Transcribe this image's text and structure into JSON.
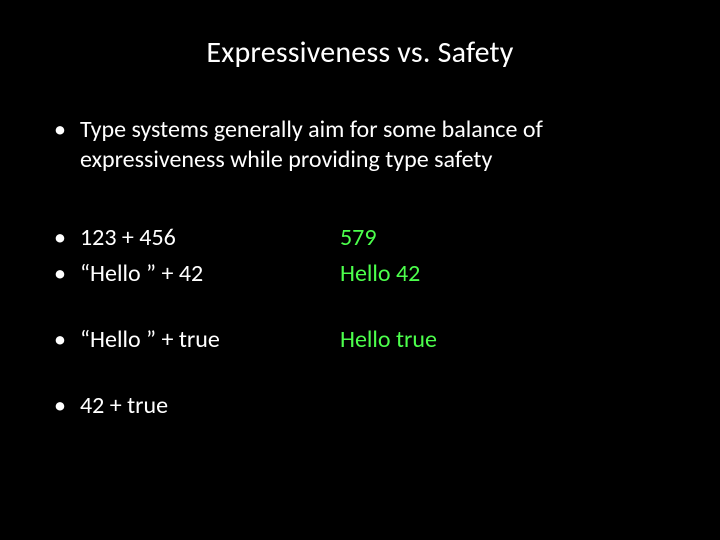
{
  "title": "Expressiveness vs. Safety",
  "intro": "Type systems generally aim for some balance of expressiveness while providing type safety",
  "rows": [
    {
      "lhs": "123 + 456",
      "rhs": "579"
    },
    {
      "lhs": "“Hello ” + 42",
      "rhs": "Hello 42"
    },
    {
      "lhs": "“Hello ” + true",
      "rhs": "Hello true"
    },
    {
      "lhs": "42 + true",
      "rhs": ""
    }
  ],
  "colors": {
    "background": "#000000",
    "text": "#ffffff",
    "result": "#4cff4c"
  }
}
